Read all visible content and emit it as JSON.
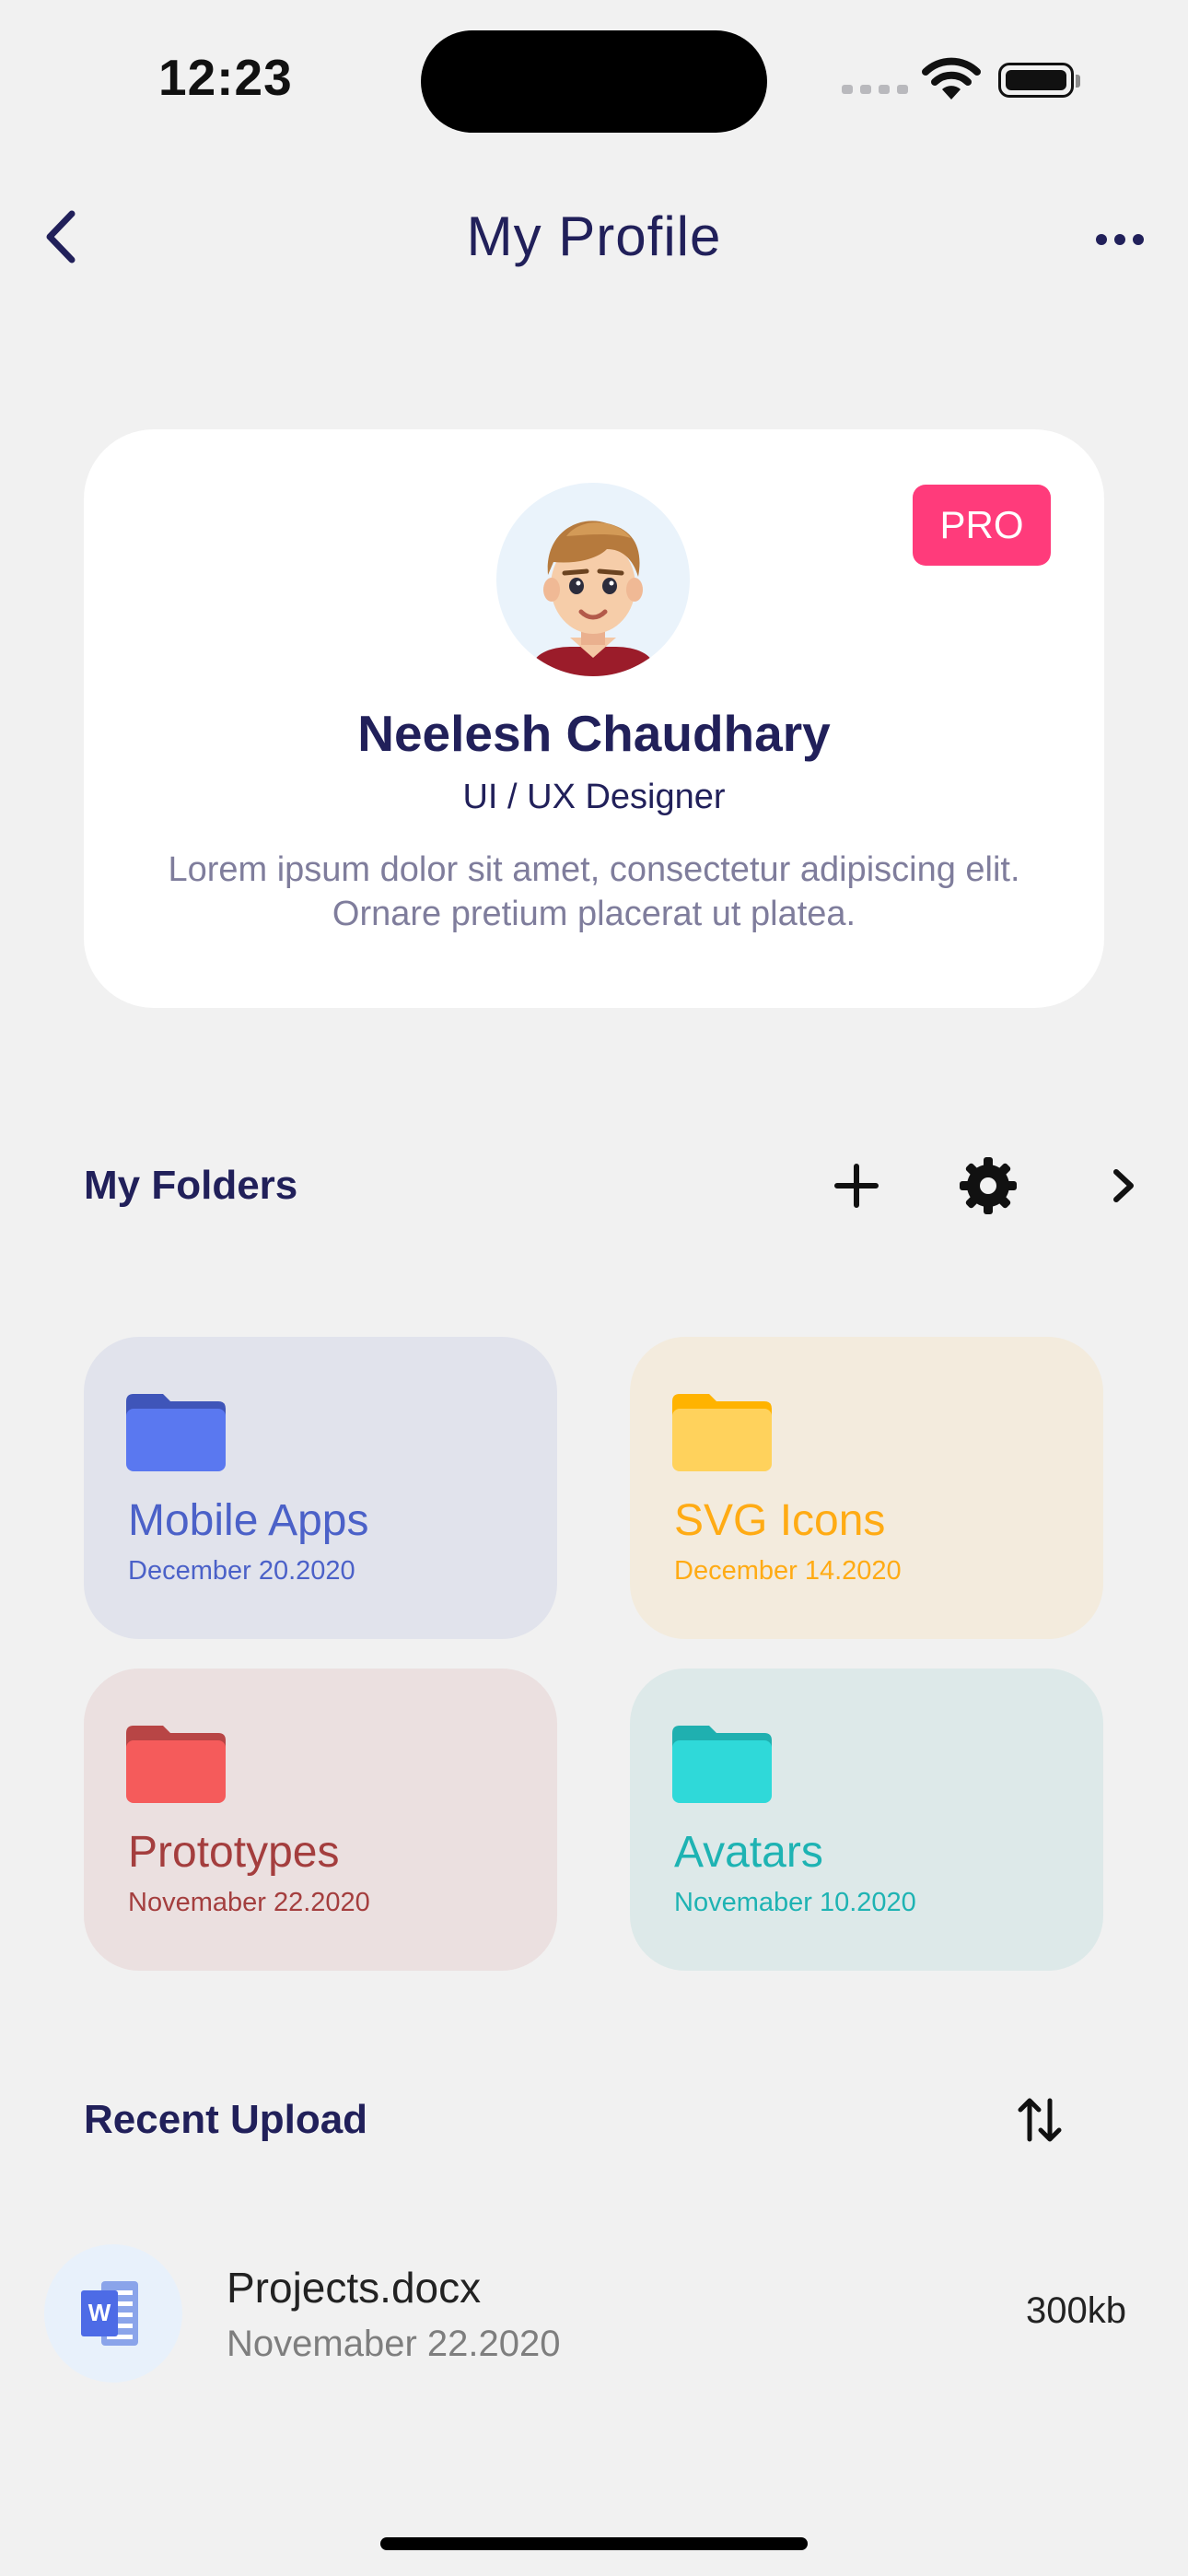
{
  "status_bar": {
    "time": "12:23"
  },
  "nav": {
    "title": "My Profile"
  },
  "profile": {
    "badge": "PRO",
    "name": "Neelesh Chaudhary",
    "role": "UI / UX Designer",
    "bio": "Lorem ipsum dolor sit amet, consectetur adipiscing elit. Ornare pretium placerat ut platea."
  },
  "folders_section": {
    "title": "My Folders",
    "items": [
      {
        "name": "Mobile Apps",
        "date": "December 20.2020",
        "bg": "#e1e3ec",
        "accent": "#4b61c8",
        "icon_front": "#5a78f0",
        "icon_back": "#3f55b9"
      },
      {
        "name": "SVG Icons",
        "date": "December 14.2020",
        "bg": "#f3ebdd",
        "accent": "#ffab14",
        "icon_front": "#ffd25c",
        "icon_back": "#ffb300"
      },
      {
        "name": "Prototypes",
        "date": "Novemaber 22.2020",
        "bg": "#ebe0e0",
        "accent": "#a43e3e",
        "icon_front": "#f55b5b",
        "icon_back": "#b84545"
      },
      {
        "name": "Avatars",
        "date": "Novemaber 10.2020",
        "bg": "#dde9e9",
        "accent": "#1eb3b3",
        "icon_front": "#2fd9d9",
        "icon_back": "#1fb0b0"
      }
    ]
  },
  "recent_section": {
    "title": "Recent Upload",
    "files": [
      {
        "name": "Projects.docx",
        "date": "Novemaber 22.2020",
        "size": "300kb"
      }
    ]
  }
}
